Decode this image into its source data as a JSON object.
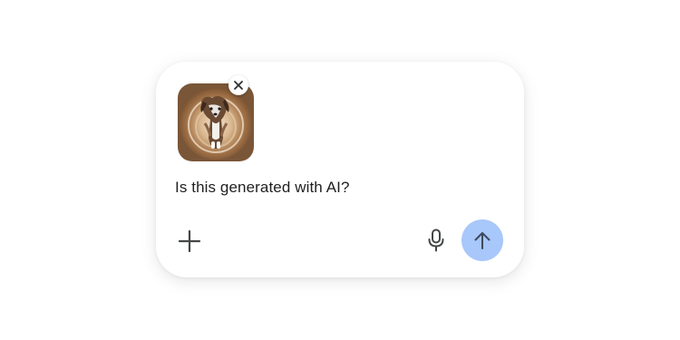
{
  "composer": {
    "prompt_text": "Is this generated with AI?",
    "attachment": {
      "image_subject": "dog-latte-art-photo",
      "remove_icon": "close-icon"
    },
    "add_icon": "plus-icon",
    "mic_icon": "microphone-icon",
    "send_icon": "arrow-up-icon"
  },
  "colors": {
    "send_button_bg": "#a8c7fa",
    "icon_color": "#444746",
    "text_color": "#1f1f1f",
    "background": "#ffffff"
  }
}
